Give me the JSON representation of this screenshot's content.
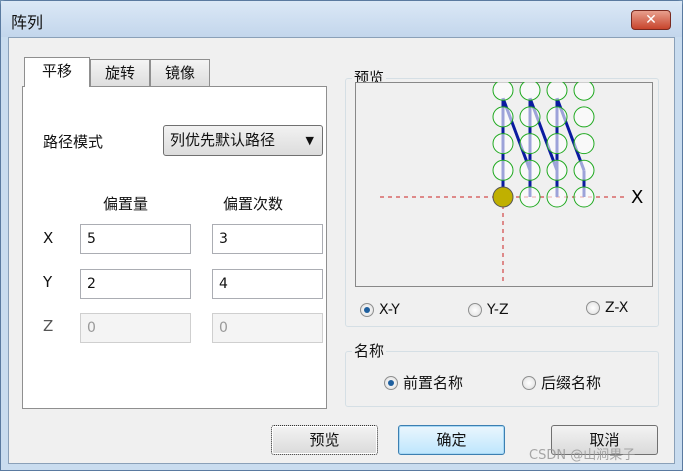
{
  "window": {
    "title": "阵列",
    "close_icon": "close-icon"
  },
  "tabs": [
    {
      "label": "平移",
      "active": true
    },
    {
      "label": "旋转"
    },
    {
      "label": "镜像"
    }
  ],
  "path_mode": {
    "label": "路径模式",
    "value": "列优先默认路径"
  },
  "offset": {
    "col_offset": "偏置量",
    "col_count": "偏置次数",
    "rows": [
      {
        "axis": "X",
        "offset": "5",
        "count": "3",
        "enabled": true
      },
      {
        "axis": "Y",
        "offset": "2",
        "count": "4",
        "enabled": true
      },
      {
        "axis": "Z",
        "offset": "0",
        "count": "0",
        "enabled": false
      }
    ]
  },
  "preview": {
    "label": "预览",
    "axis_label": "X",
    "planes": [
      {
        "label": "X-Y",
        "selected": true
      },
      {
        "label": "Y-Z"
      },
      {
        "label": "Z-X"
      }
    ],
    "grid": {
      "columns": 4,
      "rows": 5
    },
    "colors": {
      "node": "#22aa22",
      "origin": "#c0b000",
      "path": "#0a1aa0",
      "axis": "#cc2222"
    }
  },
  "name": {
    "label": "名称",
    "options": [
      {
        "label": "前置名称",
        "selected": true
      },
      {
        "label": "后缀名称"
      }
    ]
  },
  "buttons": {
    "preview": "预览",
    "ok": "确定",
    "cancel": "取消"
  },
  "watermark": "CSDN @山涧果子"
}
